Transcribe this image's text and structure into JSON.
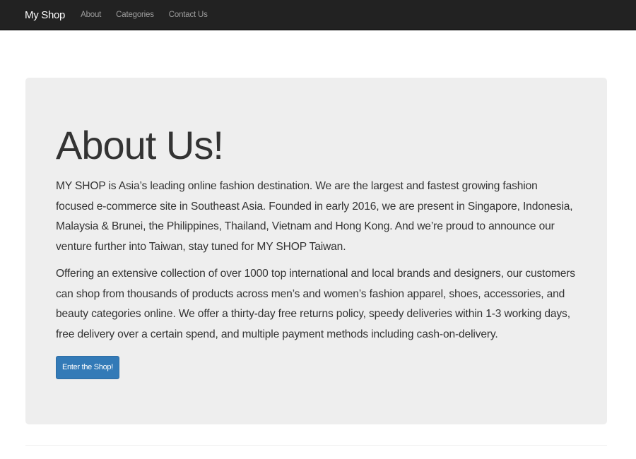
{
  "navbar": {
    "brand": "My Shop",
    "links": [
      "About",
      "Categories",
      "Contact Us"
    ]
  },
  "hero": {
    "title": "About Us!",
    "paragraphs": [
      "MY SHOP is Asia’s leading online fashion destination. We are the largest and fastest growing fashion focused e-commerce site in Southeast Asia. Founded in early 2016, we are present in Singapore, Indonesia, Malaysia & Brunei, the Philippines, Thailand, Vietnam and Hong Kong. And we’re proud to announce our venture further into Taiwan, stay tuned for MY SHOP Taiwan.",
      "Offering an extensive collection of over 1000 top international and local brands and designers, our customers can shop from thousands of products across men’s and women’s fashion apparel, shoes, accessories, and beauty categories online. We offer a thirty-day free returns policy, speedy deliveries within 1-3 working days, free delivery over a certain spend, and multiple payment methods including cash-on-delivery."
    ],
    "button_label": "Enter the Shop!"
  },
  "colors": {
    "navbar_bg": "#222222",
    "jumbotron_bg": "#eeeeee",
    "primary_button": "#337ab7"
  }
}
